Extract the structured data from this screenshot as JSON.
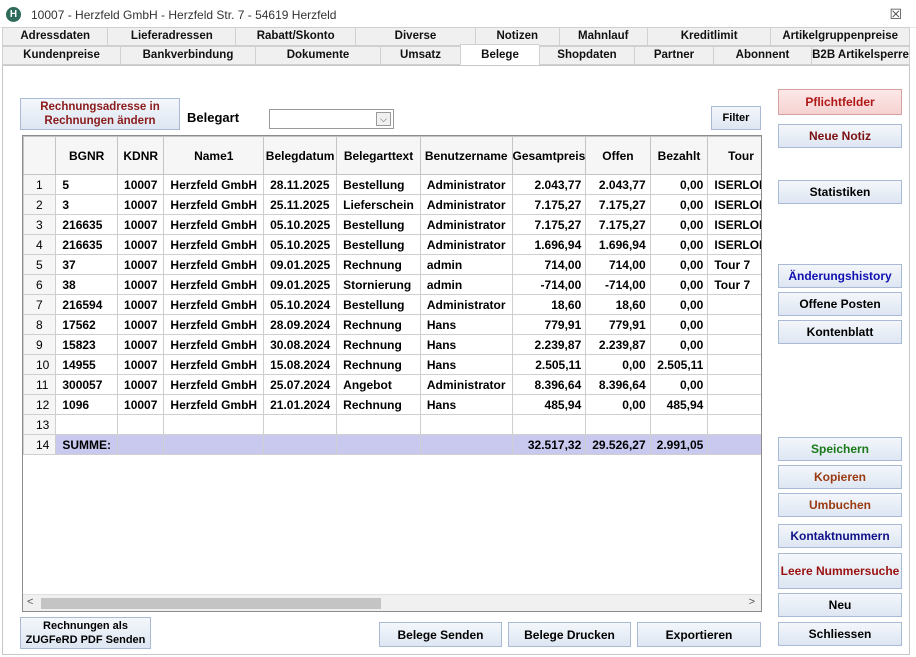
{
  "window": {
    "icon_letter": "H",
    "title": "10007  -  Herzfeld GmbH  - Herzfeld Str. 7 - 54619 Herzfeld",
    "close_glyph": "☒"
  },
  "tabs_row1": [
    "Adressdaten",
    "Lieferadressen",
    "Rabatt/Skonto",
    "Diverse",
    "Notizen",
    "Mahnlauf",
    "Kreditlimit",
    "Artikelgruppenpreise"
  ],
  "tabs_row2": [
    "Kundenpreise",
    "Bankverbindung",
    "Dokumente",
    "Umsatz",
    "Belege",
    "Shopdaten",
    "Partner",
    "Abonnent",
    "B2B Artikelsperre"
  ],
  "active_tab": "Belege",
  "toolbar": {
    "rechnungsadresse_label": "Rechnungsadresse in Rechnungen ändern",
    "belegart_label": "Belegart",
    "belegart_value": "",
    "filter_label": "Filter"
  },
  "grid": {
    "columns": [
      "",
      "BGNR",
      "KDNR",
      "Name1",
      "Belegdatum",
      "Belegarttext",
      "Benutzername",
      "Gesamtpreis",
      "Offen",
      "Bezahlt",
      "Tour"
    ],
    "rows": [
      [
        "1",
        "5",
        "10007",
        "Herzfeld GmbH",
        "28.11.2025",
        "Bestellung",
        "Administrator",
        "2.043,77",
        "2.043,77",
        "0,00",
        "ISERLOH"
      ],
      [
        "2",
        "3",
        "10007",
        "Herzfeld GmbH",
        "25.11.2025",
        "Lieferschein",
        "Administrator",
        "7.175,27",
        "7.175,27",
        "0,00",
        "ISERLOH"
      ],
      [
        "3",
        "216635",
        "10007",
        "Herzfeld GmbH",
        "05.10.2025",
        "Bestellung",
        "Administrator",
        "7.175,27",
        "7.175,27",
        "0,00",
        "ISERLOH"
      ],
      [
        "4",
        "216635",
        "10007",
        "Herzfeld GmbH",
        "05.10.2025",
        "Bestellung",
        "Administrator",
        "1.696,94",
        "1.696,94",
        "0,00",
        "ISERLOH"
      ],
      [
        "5",
        "37",
        "10007",
        "Herzfeld GmbH",
        "09.01.2025",
        "Rechnung",
        "admin",
        "714,00",
        "714,00",
        "0,00",
        "Tour 7"
      ],
      [
        "6",
        "38",
        "10007",
        "Herzfeld GmbH",
        "09.01.2025",
        "Stornierung",
        "admin",
        "-714,00",
        "-714,00",
        "0,00",
        "Tour 7"
      ],
      [
        "7",
        "216594",
        "10007",
        "Herzfeld GmbH",
        "05.10.2024",
        "Bestellung",
        "Administrator",
        "18,60",
        "18,60",
        "0,00",
        ""
      ],
      [
        "8",
        "17562",
        "10007",
        "Herzfeld GmbH",
        "28.09.2024",
        "Rechnung",
        "Hans",
        "779,91",
        "779,91",
        "0,00",
        ""
      ],
      [
        "9",
        "15823",
        "10007",
        "Herzfeld GmbH",
        "30.08.2024",
        "Rechnung",
        "Hans",
        "2.239,87",
        "2.239,87",
        "0,00",
        ""
      ],
      [
        "10",
        "14955",
        "10007",
        "Herzfeld GmbH",
        "15.08.2024",
        "Rechnung",
        "Hans",
        "2.505,11",
        "0,00",
        "2.505,11",
        ""
      ],
      [
        "11",
        "300057",
        "10007",
        "Herzfeld GmbH",
        "25.07.2024",
        "Angebot",
        "Administrator",
        "8.396,64",
        "8.396,64",
        "0,00",
        ""
      ],
      [
        "12",
        "1096",
        "10007",
        "Herzfeld GmbH",
        "21.01.2024",
        "Rechnung",
        "Hans",
        "485,94",
        "0,00",
        "485,94",
        ""
      ],
      [
        "13",
        "",
        "",
        "",
        "",
        "",
        "",
        "",
        "",
        "",
        ""
      ]
    ],
    "sum_row": [
      "14",
      "SUMME:",
      "",
      "",
      "",
      "",
      "",
      "32.517,32",
      "29.526,27",
      "2.991,05",
      ""
    ],
    "scroll_left": "<",
    "scroll_right": ">"
  },
  "bottom": {
    "zugferd_label": "Rechnungen als ZUGFeRD PDF Senden",
    "belege_senden_label": "Belege Senden",
    "belege_drucken_label": "Belege Drucken",
    "exportieren_label": "Exportieren"
  },
  "side": {
    "pflichtfelder": "Pflichtfelder",
    "neue_notiz": "Neue Notiz",
    "statistiken": "Statistiken",
    "aenderungshistory": "Änderungshistory",
    "offene_posten": "Offene Posten",
    "kontenblatt": "Kontenblatt",
    "speichern": "Speichern",
    "kopieren": "Kopieren",
    "umbuchen": "Umbuchen",
    "kontaktnummern": "Kontaktnummern",
    "leere_nummersuche": "Leere Nummersuche",
    "neu": "Neu",
    "schliessen": "Schliessen"
  },
  "colors": {
    "sum_row_bg": "#c9c9f0",
    "pflichtfelder_text": "#b01818",
    "speichern_text": "#1a7a1a",
    "aenderungshistory_text": "#1010b0"
  }
}
